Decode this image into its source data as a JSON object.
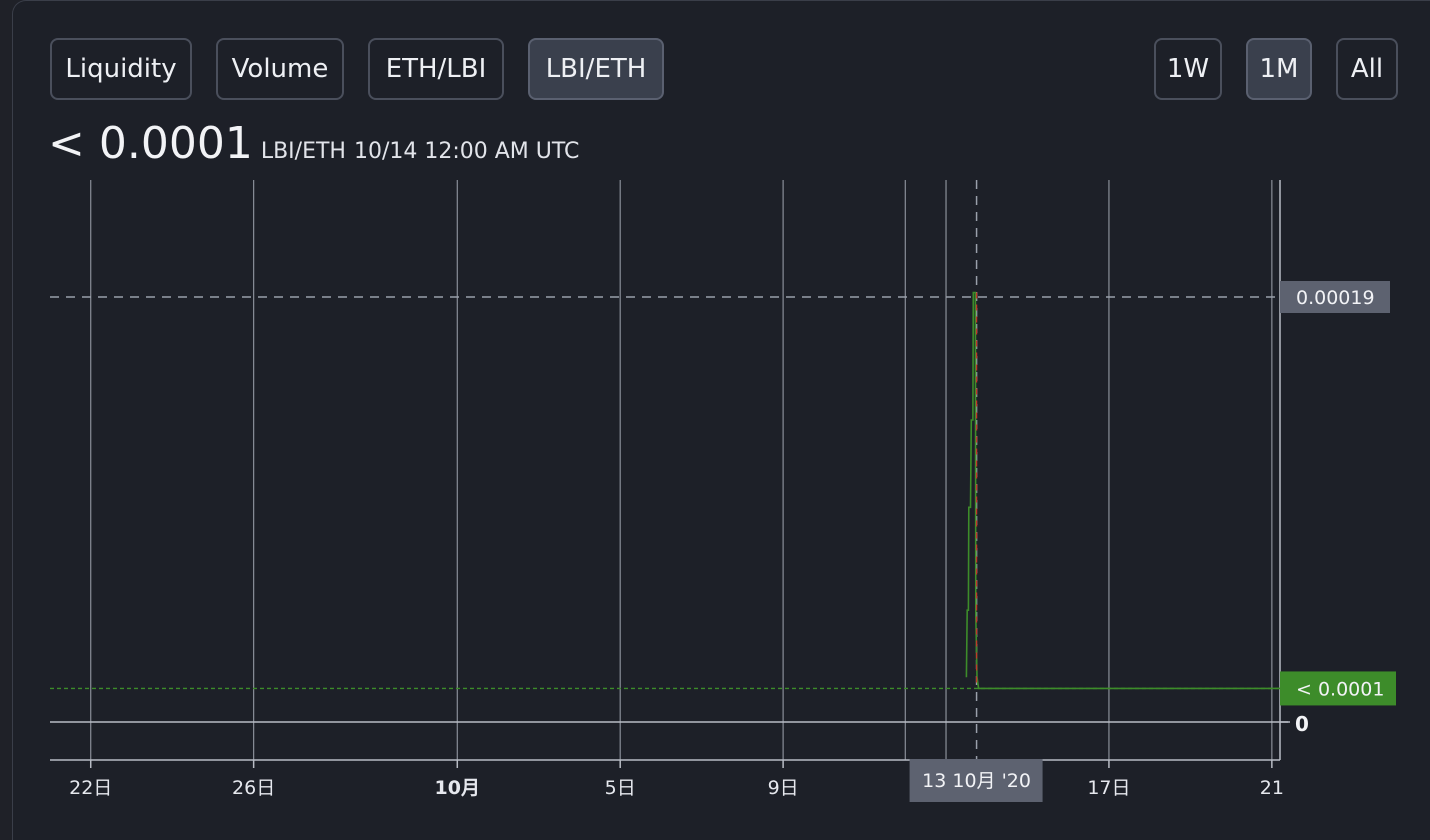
{
  "tabs": [
    {
      "label": "Liquidity",
      "active": false
    },
    {
      "label": "Volume",
      "active": false
    },
    {
      "label": "ETH/LBI",
      "active": false
    },
    {
      "label": "LBI/ETH",
      "active": true
    }
  ],
  "ranges": [
    {
      "label": "1W",
      "active": false
    },
    {
      "label": "1M",
      "active": true
    },
    {
      "label": "All",
      "active": false
    }
  ],
  "header": {
    "price": "< 0.0001",
    "pair": "LBI/ETH",
    "timestamp": "10/14 12:00 AM UTC"
  },
  "colors": {
    "line": "#3d8c2a",
    "crosshair": "#9aa0ab",
    "marker_red": "#c0392b",
    "last_price_badge": "#3d8c2a",
    "crosshair_badge": "#5d6270"
  },
  "chart_data": {
    "type": "line",
    "x_ticks": [
      "22日",
      "26日",
      "10月",
      "5日",
      "9日",
      "13",
      "17日",
      "21"
    ],
    "x_tick_days": [
      -8,
      -4,
      1,
      5,
      9,
      13,
      17,
      21
    ],
    "x_range_days": [
      -9,
      21.2
    ],
    "y_range": [
      0,
      0.000224
    ],
    "x_unit": "day of October 2020 (negative = September)",
    "series": [
      {
        "points": [
          [
            13.5,
            2e-05
          ],
          [
            13.52,
            5e-05
          ],
          [
            13.55,
            5e-05
          ],
          [
            13.56,
            9.6e-05
          ],
          [
            13.6,
            9.6e-05
          ],
          [
            13.62,
            0.000135
          ],
          [
            13.66,
            0.000135
          ],
          [
            13.67,
            0.000192
          ],
          [
            13.72,
            0.000192
          ],
          [
            13.73,
            4.75e-05
          ],
          [
            13.76,
            2e-05
          ],
          [
            13.8,
            1.5e-05
          ],
          [
            14.0,
            1.5e-05
          ],
          [
            21.2,
            1.5e-05
          ]
        ]
      }
    ],
    "y_labels": {
      "zero": "0",
      "crosshair_value": "0.00019",
      "last_value": "< 0.0001"
    },
    "crosshair": {
      "x_label": "13 10月 '20",
      "x_day": 13.75,
      "y_value": 0.00019
    },
    "last_value_y": 1.5e-05,
    "grid": true
  }
}
